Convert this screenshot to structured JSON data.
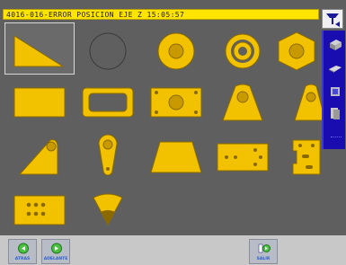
{
  "status": {
    "text": "4016-016-ERROR POSICION EJE Z 15:05:57"
  },
  "colors": {
    "shape_fill": "#f2c200",
    "shape_stroke": "#8a6a00",
    "panel_bg": "#5f5f5f",
    "status_bg": "#ffe400",
    "toolbar_bg": "#1a0db0"
  },
  "shapes": [
    {
      "name": "triangle"
    },
    {
      "name": "circle-outline"
    },
    {
      "name": "circle-with-hole"
    },
    {
      "name": "concentric-rings"
    },
    {
      "name": "hexagon-with-hole"
    },
    {
      "name": "rectangle"
    },
    {
      "name": "rectangle-frame"
    },
    {
      "name": "plate-with-corner-holes"
    },
    {
      "name": "trapezoid-with-hole"
    },
    {
      "name": "trapezoid-with-hole-partial"
    },
    {
      "name": "triangle-with-hole"
    },
    {
      "name": "keyhole"
    },
    {
      "name": "trapezoid"
    },
    {
      "name": "plate-with-hole-pattern"
    },
    {
      "name": "plate-with-slots"
    },
    {
      "name": "plate-with-hole-grid"
    },
    {
      "name": "fan-sector"
    }
  ],
  "side_toolbar": {
    "icons": [
      "cube-icon",
      "plate-icon",
      "folder-icon",
      "stack-icon"
    ]
  },
  "nav": {
    "back_label": "ATRAS",
    "forward_label": "ADELANTE",
    "exit_label": "SALIR"
  }
}
